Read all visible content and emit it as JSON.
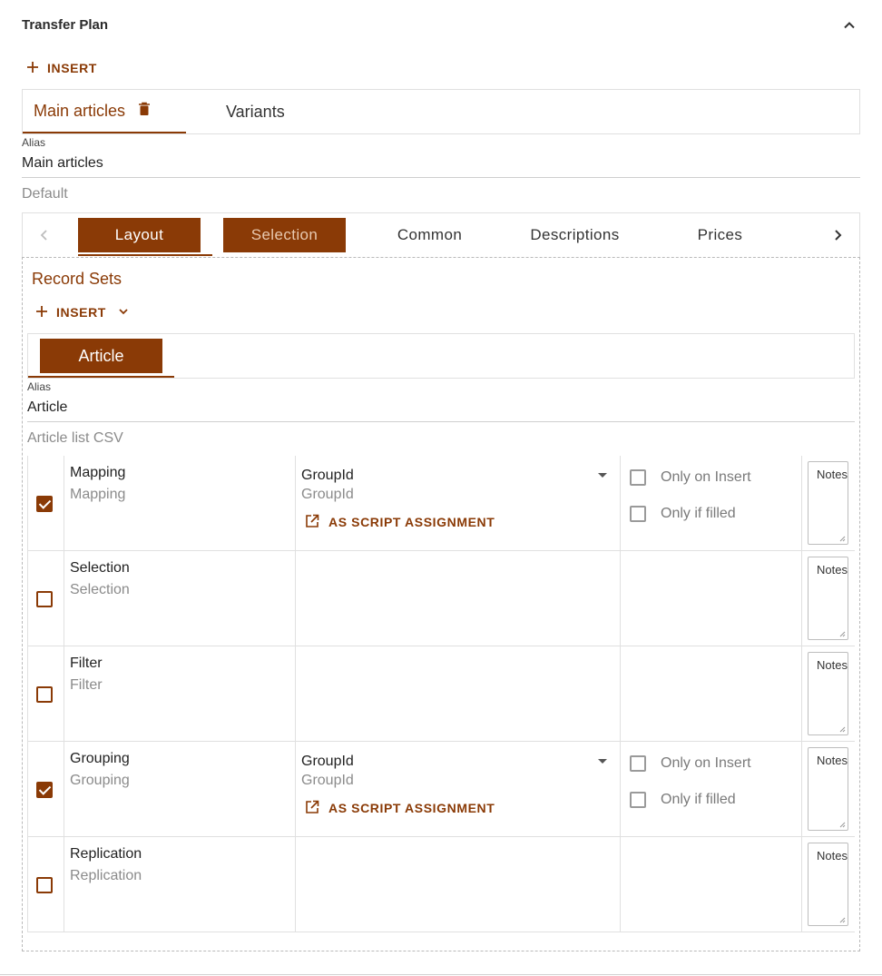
{
  "header": {
    "title": "Transfer Plan",
    "insert_label": "INSERT"
  },
  "top_tabs": [
    {
      "label": "Main articles",
      "active": true
    },
    {
      "label": "Variants",
      "active": false
    }
  ],
  "plan": {
    "alias_label": "Alias",
    "alias_value": "Main articles",
    "description": "Default"
  },
  "sub_tabs": [
    {
      "label": "Layout",
      "state": "active"
    },
    {
      "label": "Selection",
      "state": "selected"
    },
    {
      "label": "Common",
      "state": "normal"
    },
    {
      "label": "Descriptions",
      "state": "normal"
    },
    {
      "label": "Prices",
      "state": "normal"
    }
  ],
  "record_sets": {
    "title": "Record Sets",
    "insert_label": "INSERT",
    "tab_label": "Article",
    "alias_label": "Alias",
    "alias_value": "Article",
    "description": "Article list CSV"
  },
  "rows": [
    {
      "checked": true,
      "name": "Mapping",
      "sub": "Mapping",
      "field": "GroupId",
      "field_sub": "GroupId",
      "script_label": "AS SCRIPT ASSIGNMENT",
      "opt_insert": "Only on Insert",
      "opt_filled": "Only if filled",
      "notes": "Notes"
    },
    {
      "checked": false,
      "name": "Selection",
      "sub": "Selection",
      "notes": "Notes"
    },
    {
      "checked": false,
      "name": "Filter",
      "sub": "Filter",
      "notes": "Notes"
    },
    {
      "checked": true,
      "name": "Grouping",
      "sub": "Grouping",
      "field": "GroupId",
      "field_sub": "GroupId",
      "script_label": "AS SCRIPT ASSIGNMENT",
      "opt_insert": "Only on Insert",
      "opt_filled": "Only if filled",
      "notes": "Notes"
    },
    {
      "checked": false,
      "name": "Replication",
      "sub": "Replication",
      "notes": "Notes"
    }
  ],
  "colors": {
    "accent": "#8a3a06",
    "border": "#e0e0e0",
    "muted_text": "#8b8b8b"
  },
  "icons": [
    "chevron-up-icon",
    "plus-icon",
    "trash-icon",
    "chevron-left-icon",
    "chevron-right-icon",
    "chevron-down-icon",
    "open-external-icon"
  ]
}
